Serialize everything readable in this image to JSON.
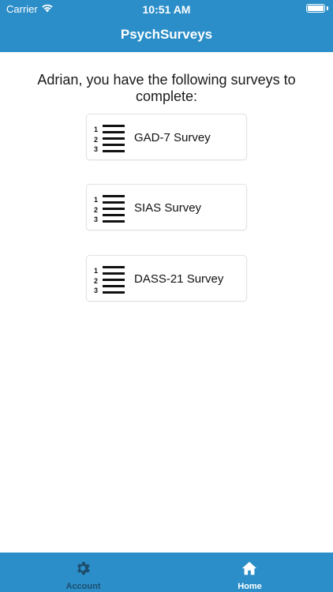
{
  "status_bar": {
    "carrier": "Carrier",
    "time": "10:51 AM"
  },
  "header": {
    "title": "PsychSurveys"
  },
  "main": {
    "greeting": "Adrian, you have the following surveys to complete:",
    "surveys": [
      {
        "label": "GAD-7 Survey",
        "icon": "numbered-list-icon"
      },
      {
        "label": "SIAS Survey",
        "icon": "numbered-list-icon"
      },
      {
        "label": "DASS-21 Survey",
        "icon": "numbered-list-icon"
      }
    ]
  },
  "tab_bar": {
    "tabs": [
      {
        "label": "Account",
        "icon": "gear-icon",
        "active": false
      },
      {
        "label": "Home",
        "icon": "home-icon",
        "active": true
      }
    ]
  },
  "colors": {
    "brand_blue": "#2b8ec8",
    "inactive_tab": "#1e4e6e",
    "card_border": "#e2e2e2"
  }
}
